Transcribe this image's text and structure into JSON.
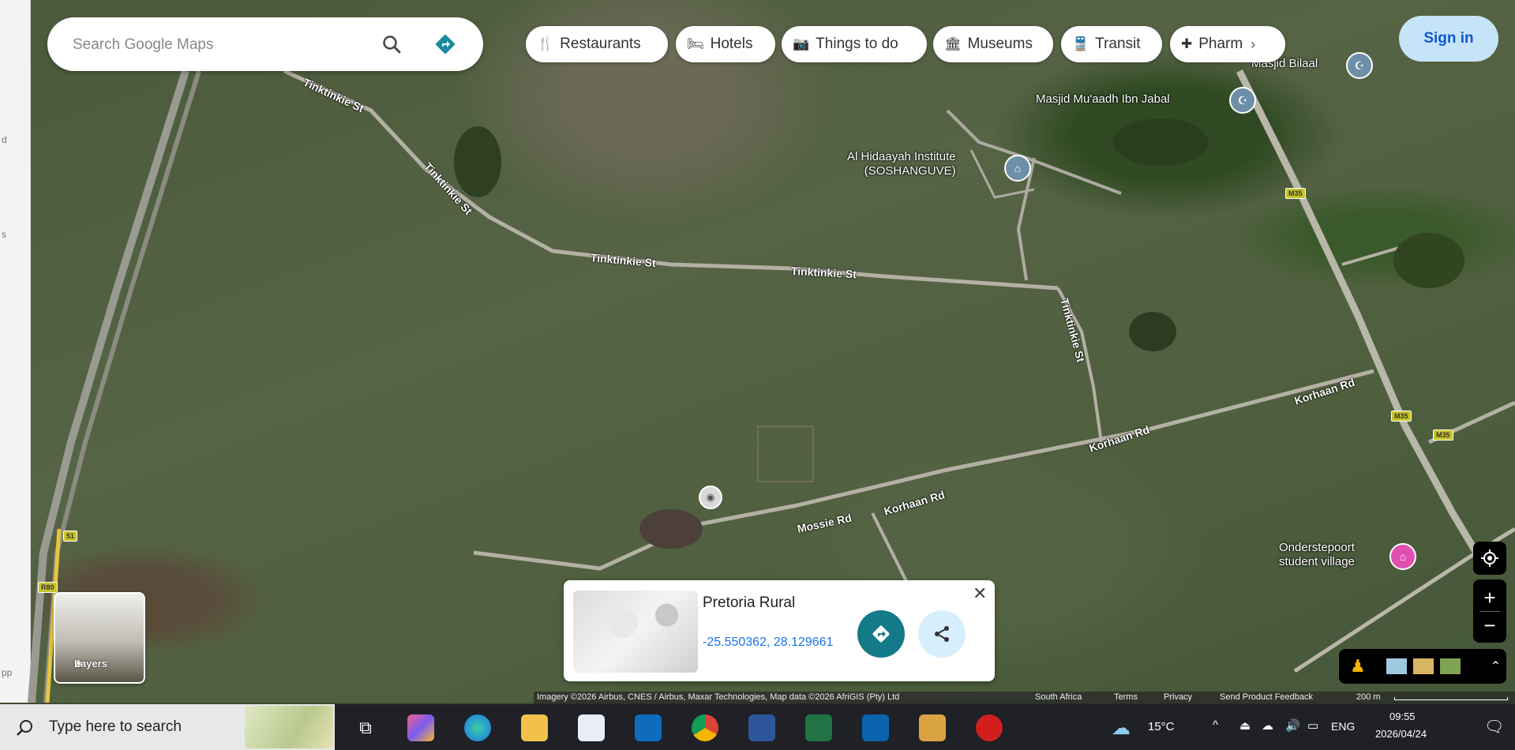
{
  "search": {
    "placeholder": "Search Google Maps"
  },
  "chips": [
    {
      "label": "Restaurants",
      "icon": "fork-knife-icon"
    },
    {
      "label": "Hotels",
      "icon": "bed-icon"
    },
    {
      "label": "Things to do",
      "icon": "camera-icon"
    },
    {
      "label": "Museums",
      "icon": "museum-icon"
    },
    {
      "label": "Transit",
      "icon": "train-icon"
    },
    {
      "label": "Pharm",
      "icon": "pharmacy-icon"
    }
  ],
  "sign_in": "Sign in",
  "left_strip": [
    "d",
    "s",
    "pp"
  ],
  "road_labels": {
    "tinktinkie_1": "Tinktinkie St",
    "tinktinkie_2": "Tinktinkie St",
    "tinktinkie_3": "Tinktinkie St",
    "tinktinkie_4": "Tinktinkie St",
    "tinktinkie_5": "Tinktinkie St",
    "korhaan_1": "Korhaan Rd",
    "korhaan_2": "Korhaan Rd",
    "korhaan_3": "Korhaan Rd",
    "mossie": "Mossie Rd"
  },
  "shields": {
    "m35_a": "M35",
    "m35_b": "M35",
    "m35_c": "M35",
    "r_a": "51",
    "r_b": "R80"
  },
  "pois": {
    "masjid_bilaal": "Masjid Bilaal",
    "masjid_muaadh": "Masjid Mu'aadh Ibn Jabal",
    "al_hidaayah_1": "Al Hidaayah Institute",
    "al_hidaayah_2": "(SOSHANGUVE)",
    "onderstepoort_1": "Onderstepoort",
    "onderstepoort_2": "student village"
  },
  "place_card": {
    "title": "Pretoria Rural",
    "coords": "-25.550362, 28.129661"
  },
  "layers_label": "Layers",
  "attribution": {
    "imagery": "Imagery ©2026 Airbus, CNES / Airbus, Maxar Technologies, Map data ©2026 AfriGIS (Pty) Ltd",
    "country": "South Africa",
    "terms": "Terms",
    "privacy": "Privacy",
    "feedback": "Send Product Feedback",
    "scale": "200 m"
  },
  "taskbar": {
    "search_placeholder": "Type here to search",
    "weather": "15°C",
    "lang": "ENG",
    "time": "09:55",
    "date": "2026/04/24"
  },
  "colors": {
    "signin_bg": "#c6e4f8",
    "direction_btn": "#157a87",
    "poi_pink": "#e14fb0",
    "shield_yellow": "#c7c42b"
  }
}
